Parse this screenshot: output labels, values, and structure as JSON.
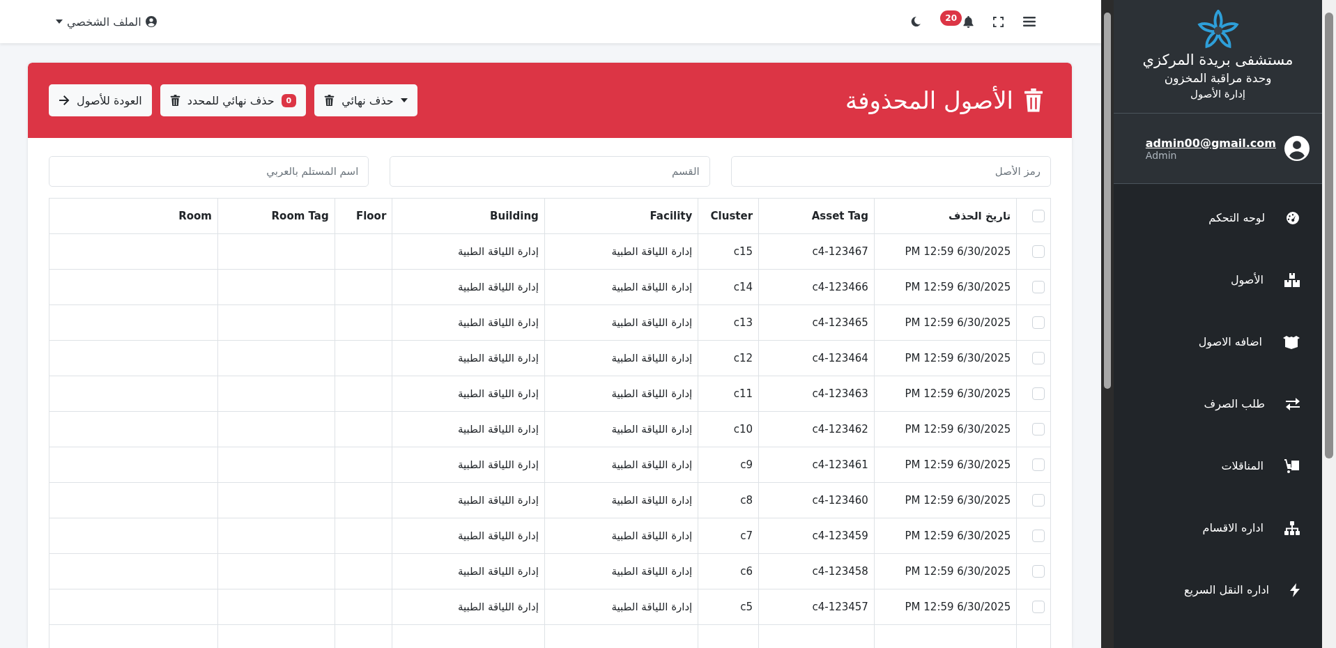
{
  "topbar": {
    "menu_label": "الملف الشخصي",
    "notification_count": "20"
  },
  "header": {
    "title": "الأصول المحذوفة",
    "buttons": [
      {
        "kind": "dropdown",
        "label": "حذف نهائي"
      },
      {
        "kind": "badge",
        "label": "حذف نهائي للمحدد",
        "badge": "0"
      },
      {
        "kind": "back",
        "label": "العودة للأصول"
      }
    ]
  },
  "filters": [
    {
      "placeholder": "رمز الأصل"
    },
    {
      "placeholder": "القسم"
    },
    {
      "placeholder": "اسم المستلم بالعربي"
    }
  ],
  "table": {
    "select_all_checked": false,
    "columns": [
      "تاريخ الحذف",
      "Asset Tag",
      "Cluster",
      "Facility",
      "Building",
      "Floor",
      "Room Tag",
      "Room"
    ],
    "rows": [
      {
        "checked": false,
        "cells": [
          "6/30/2025 12:59 PM",
          "c4-123467",
          "c15",
          "إدارة اللياقة الطبية",
          "إدارة اللياقة الطبية",
          "",
          "",
          ""
        ]
      },
      {
        "checked": false,
        "cells": [
          "6/30/2025 12:59 PM",
          "c4-123466",
          "c14",
          "إدارة اللياقة الطبية",
          "إدارة اللياقة الطبية",
          "",
          "",
          ""
        ]
      },
      {
        "checked": false,
        "cells": [
          "6/30/2025 12:59 PM",
          "c4-123465",
          "c13",
          "إدارة اللياقة الطبية",
          "إدارة اللياقة الطبية",
          "",
          "",
          ""
        ]
      },
      {
        "checked": false,
        "cells": [
          "6/30/2025 12:59 PM",
          "c4-123464",
          "c12",
          "إدارة اللياقة الطبية",
          "إدارة اللياقة الطبية",
          "",
          "",
          ""
        ]
      },
      {
        "checked": false,
        "cells": [
          "6/30/2025 12:59 PM",
          "c4-123463",
          "c11",
          "إدارة اللياقة الطبية",
          "إدارة اللياقة الطبية",
          "",
          "",
          ""
        ]
      },
      {
        "checked": false,
        "cells": [
          "6/30/2025 12:59 PM",
          "c4-123462",
          "c10",
          "إدارة اللياقة الطبية",
          "إدارة اللياقة الطبية",
          "",
          "",
          ""
        ]
      },
      {
        "checked": false,
        "cells": [
          "6/30/2025 12:59 PM",
          "c4-123461",
          "c9",
          "إدارة اللياقة الطبية",
          "إدارة اللياقة الطبية",
          "",
          "",
          ""
        ]
      },
      {
        "checked": false,
        "cells": [
          "6/30/2025 12:59 PM",
          "c4-123460",
          "c8",
          "إدارة اللياقة الطبية",
          "إدارة اللياقة الطبية",
          "",
          "",
          ""
        ]
      },
      {
        "checked": false,
        "cells": [
          "6/30/2025 12:59 PM",
          "c4-123459",
          "c7",
          "إدارة اللياقة الطبية",
          "إدارة اللياقة الطبية",
          "",
          "",
          ""
        ]
      },
      {
        "checked": false,
        "cells": [
          "6/30/2025 12:59 PM",
          "c4-123458",
          "c6",
          "إدارة اللياقة الطبية",
          "إدارة اللياقة الطبية",
          "",
          "",
          ""
        ]
      },
      {
        "checked": false,
        "cells": [
          "6/30/2025 12:59 PM",
          "c4-123457",
          "c5",
          "إدارة اللياقة الطبية",
          "إدارة اللياقة الطبية",
          "",
          "",
          ""
        ]
      }
    ]
  },
  "sidebar": {
    "brand": [
      "مستشفى بريدة المركزي",
      "وحدة مراقبة المخزون",
      "إدارة الأصول"
    ],
    "user": {
      "email": "admin00@gmail.com",
      "role": "Admin"
    },
    "items": [
      {
        "label": "لوحه التحكم"
      },
      {
        "label": "الأصول"
      },
      {
        "label": "اضافه الاصول"
      },
      {
        "label": "طلب الصرف"
      },
      {
        "label": "المناقلات"
      },
      {
        "label": "اداره الاقسام"
      },
      {
        "label": "اداره النقل السريع"
      }
    ]
  }
}
